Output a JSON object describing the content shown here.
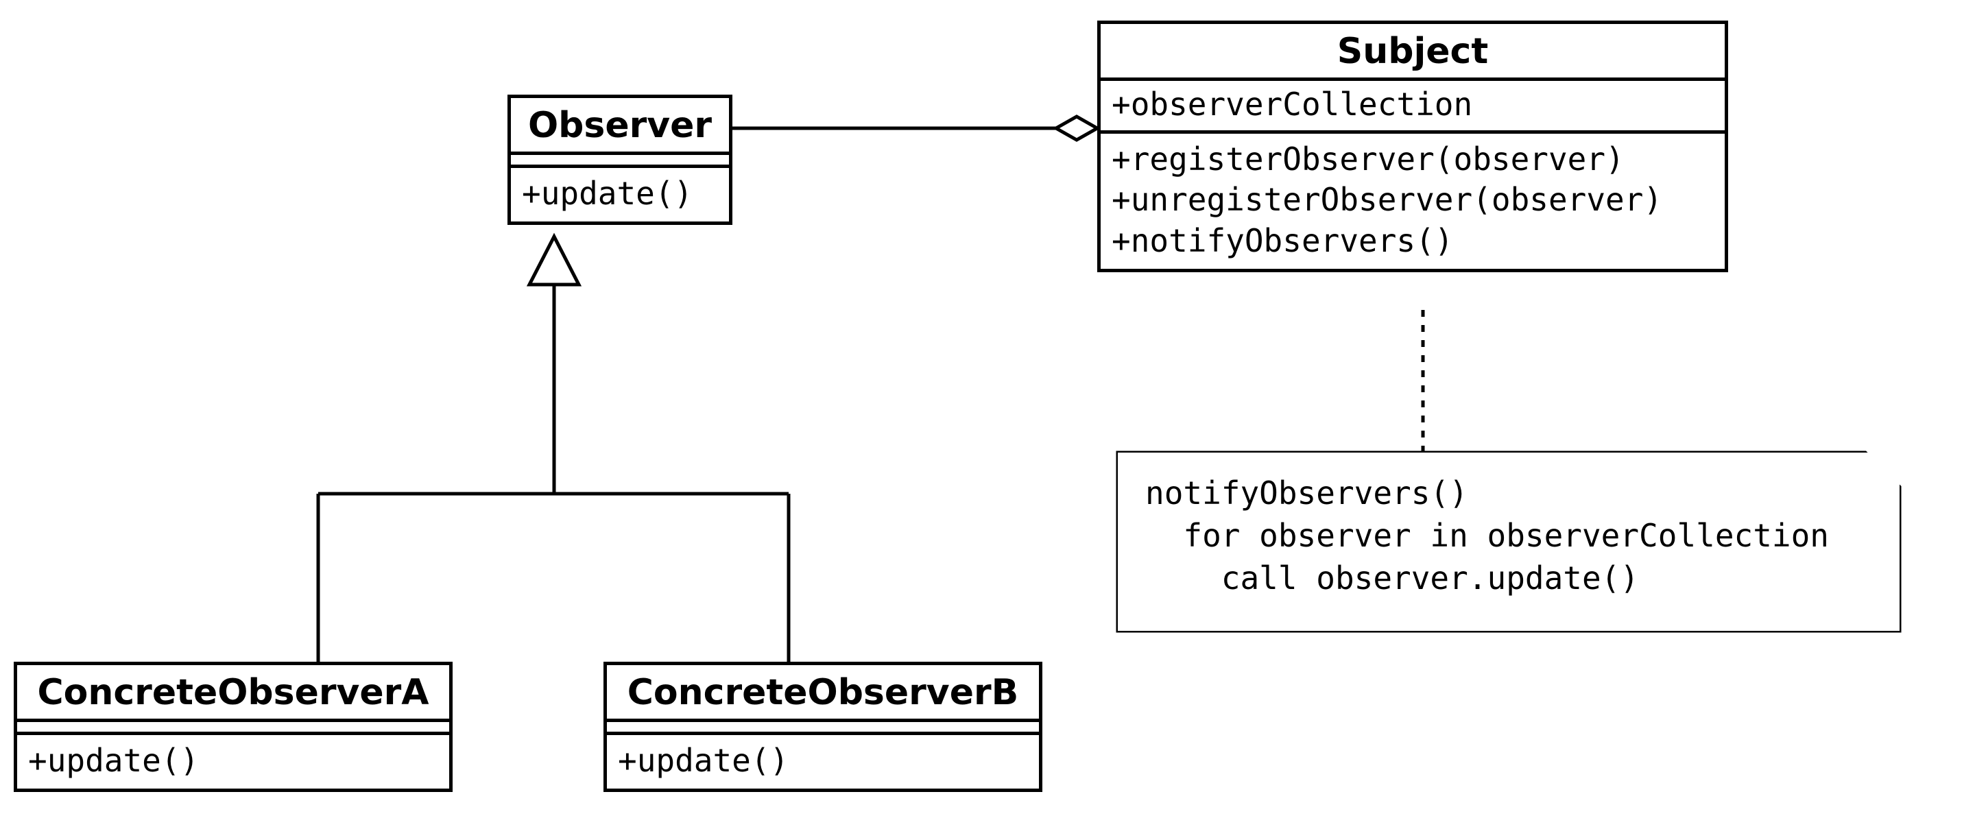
{
  "diagram": {
    "pattern": "Observer",
    "classes": {
      "observer": {
        "name": "Observer",
        "attributes": [],
        "operations": [
          "+update()"
        ]
      },
      "subject": {
        "name": "Subject",
        "attributes": [
          "+observerCollection"
        ],
        "operations": [
          "+registerObserver(observer)",
          "+unregisterObserver(observer)",
          "+notifyObservers()"
        ]
      },
      "concreteA": {
        "name": "ConcreteObserverA",
        "attributes": [],
        "operations": [
          "+update()"
        ]
      },
      "concreteB": {
        "name": "ConcreteObserverB",
        "attributes": [],
        "operations": [
          "+update()"
        ]
      }
    },
    "note": {
      "lines": [
        "notifyObservers()",
        "  for observer in observerCollection",
        "    call observer.update()"
      ]
    },
    "relationships": [
      {
        "from": "subject",
        "to": "observer",
        "type": "aggregation"
      },
      {
        "from": "concreteA",
        "to": "observer",
        "type": "generalization"
      },
      {
        "from": "concreteB",
        "to": "observer",
        "type": "generalization"
      },
      {
        "from": "note",
        "to": "subject",
        "type": "note-anchor"
      }
    ]
  }
}
